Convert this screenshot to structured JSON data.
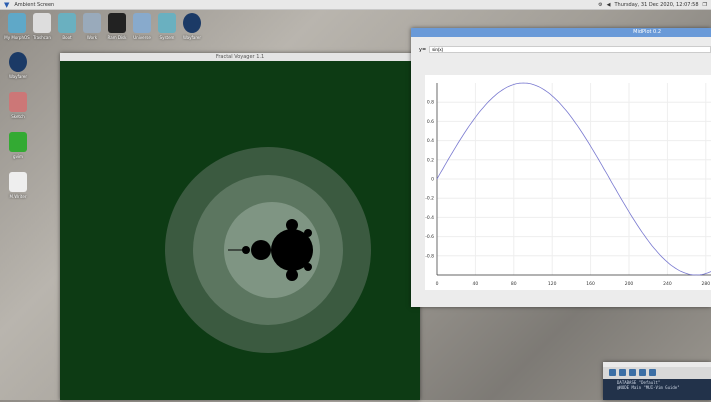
{
  "topbar": {
    "title": "Ambient Screen",
    "datetime": "Thursday, 31 Dec 2020, 12:07:58"
  },
  "desktop": {
    "icons": [
      "My MorphOS",
      "Trashcan",
      "Boot",
      "Work",
      "Ram Disk",
      "Universe",
      "System",
      "Wayfarer"
    ],
    "left_icons": [
      "Wayfarer",
      "Sketch",
      "gvim",
      "M.Writer"
    ]
  },
  "fractal": {
    "title": "Fractal Voyager 1.1"
  },
  "midplot": {
    "title": "MidPlot 0.2",
    "input_label": "y=",
    "input_value": "sin(x)"
  },
  "terminal": {
    "lines": [
      "DATABASE \"Default\"",
      "@NODE Main \"MUI-Vim Guide\""
    ]
  },
  "chart_data": {
    "type": "line",
    "function": "sin(x) (x in degrees)",
    "xlim": [
      0,
      300
    ],
    "ylim": [
      -1,
      1
    ],
    "xticks": [
      0,
      40,
      80,
      120,
      160,
      200,
      240,
      280
    ],
    "yticks": [
      0.8,
      0.6,
      0.4,
      0.2,
      0.0,
      -0.2,
      -0.4,
      -0.6,
      -0.8
    ],
    "grid": true,
    "series": [
      {
        "name": "sin(x)",
        "color": "#7a7ad0"
      }
    ]
  }
}
